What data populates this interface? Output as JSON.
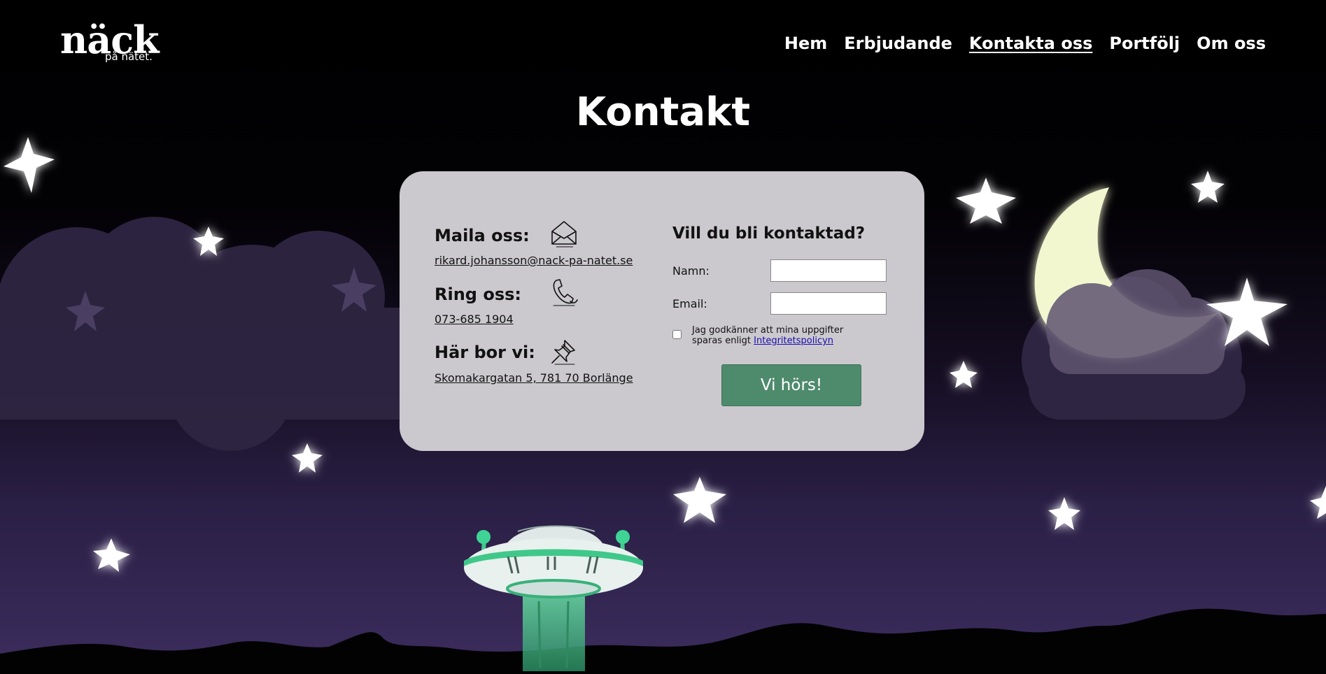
{
  "logo": {
    "main": "näck",
    "sub": "på nätet."
  },
  "nav": {
    "items": [
      {
        "label": "Hem"
      },
      {
        "label": "Erbjudande"
      },
      {
        "label": "Kontakta oss"
      },
      {
        "label": "Portfölj"
      },
      {
        "label": "Om oss"
      }
    ],
    "active": "Kontakta oss"
  },
  "page": {
    "title": "Kontakt"
  },
  "contact": {
    "mail": {
      "heading": "Maila oss:",
      "value": "rikard.johansson@nack-pa-natet.se",
      "icon": "envelope-icon"
    },
    "phone": {
      "heading": "Ring oss:",
      "value": "073-685 1904",
      "icon": "phone-icon"
    },
    "address": {
      "heading": "Här bor vi:",
      "value": "Skomakargatan 5, 781 70 Borlänge",
      "icon": "pushpin-icon"
    }
  },
  "form": {
    "heading": "Vill du bli kontaktad?",
    "name_label": "Namn:",
    "name_value": "",
    "email_label": "Email:",
    "email_value": "",
    "consent_text": "Jag godkänner att mina uppgifter sparas enligt",
    "consent_link": "Integritetspolicyn",
    "submit_label": "Vi hörs!"
  },
  "colors": {
    "card_bg": "#cbc9ce",
    "button_bg": "#4e8a6c",
    "sky_top": "#000000",
    "sky_bottom": "#3c2d5e",
    "moon": "#f2f7d0",
    "ufo_accent": "#3fc88a"
  }
}
